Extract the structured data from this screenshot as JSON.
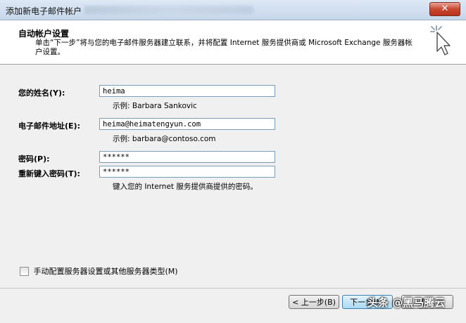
{
  "window": {
    "title": "添加新电子邮件帐户",
    "close_label": "✕"
  },
  "header": {
    "title": "自动帐户设置",
    "description": "单击“下一步”将与您的电子邮件服务器建立联系，并将配置 Internet 服务提供商或 Microsoft Exchange 服务器帐户设置。"
  },
  "form": {
    "name": {
      "label": "您的姓名(Y):",
      "value": "heima",
      "hint": "示例: Barbara Sankovic"
    },
    "email": {
      "label": "电子邮件地址(E):",
      "value": "heima@heimatengyun.com",
      "hint": "示例: barbara@contoso.com"
    },
    "password": {
      "label": "密码(P):",
      "value": "******"
    },
    "password_confirm": {
      "label": "重新键入密码(T):",
      "value": "******",
      "hint": "键入您的 Internet 服务提供商提供的密码。"
    }
  },
  "manual_config": {
    "label": "手动配置服务器设置或其他服务器类型(M)",
    "checked": false
  },
  "buttons": {
    "back": "< 上一步(B)",
    "next": "下一步(N)",
    "cancel": "取消"
  },
  "watermark": "头条 @黑马腾云"
}
